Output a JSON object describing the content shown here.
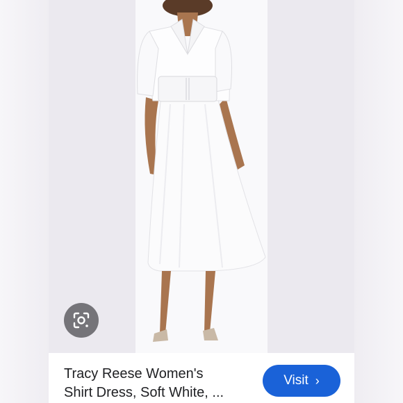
{
  "product": {
    "title_line1": "Tracy Reese Women's",
    "title_line2": "Shirt Dress, Soft White, ..."
  },
  "actions": {
    "visit_label": "Visit",
    "visit_chevron": "›"
  },
  "icons": {
    "lens": "google-lens-icon",
    "chevron": "chevron-right-icon"
  },
  "colors": {
    "visit_button": "#1a62d8",
    "lens_button_bg": "#4a4a4f",
    "page_bg": "#f2f0f5"
  }
}
